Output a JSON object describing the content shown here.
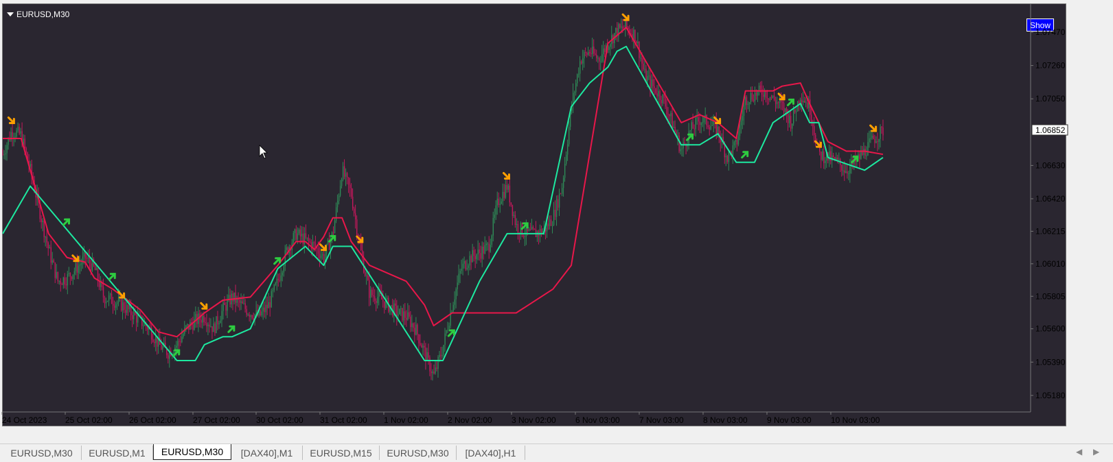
{
  "window": {
    "symbol_label": "EURUSD,M30",
    "show_button_label": "Show"
  },
  "price_axis": {
    "ticks": [
      "1.07470",
      "1.07260",
      "1.07050",
      "1.06630",
      "1.06420",
      "1.06215",
      "1.06010",
      "1.05805",
      "1.05600",
      "1.05390",
      "1.05180"
    ],
    "current_price": "1.06852"
  },
  "time_axis": {
    "labels": [
      "24 Oct 2023",
      "25 Oct 02:00",
      "26 Oct 02:00",
      "27 Oct 02:00",
      "30 Oct 02:00",
      "31 Oct 02:00",
      "1 Nov 02:00",
      "2 Nov 02:00",
      "3 Nov 02:00",
      "6 Nov 03:00",
      "7 Nov 03:00",
      "8 Nov 03:00",
      "9 Nov 03:00",
      "10 Nov 03:00"
    ]
  },
  "tabs": [
    {
      "label": "EURUSD,M30",
      "active": false
    },
    {
      "label": "EURUSD,M1",
      "active": false
    },
    {
      "label": "EURUSD,M30",
      "active": true
    },
    {
      "label": "[DAX40],M1",
      "active": false
    },
    {
      "label": "EURUSD,M15",
      "active": false
    },
    {
      "label": "EURUSD,M30",
      "active": false
    },
    {
      "label": "[DAX40],H1",
      "active": false
    }
  ],
  "colors": {
    "background": "#2a2630",
    "bull_candle": "#2e8b57",
    "bear_candle": "#c2185b",
    "upper_band": "#e8174a",
    "lower_band": "#1de9a0",
    "sell_arrow": "#ffa000",
    "buy_arrow": "#2ecc40",
    "show_button": "#0000ff"
  },
  "chart_data": {
    "type": "candlestick",
    "title": "EURUSD,M30",
    "ylim": [
      1.0508,
      1.0763
    ],
    "price_path": [
      [
        0,
        1.067
      ],
      [
        1,
        1.0685
      ],
      [
        2,
        1.0682
      ],
      [
        3,
        1.066
      ],
      [
        4,
        1.0635
      ],
      [
        5,
        1.061
      ],
      [
        6,
        1.059
      ],
      [
        7,
        1.0592
      ],
      [
        8,
        1.0598
      ],
      [
        9,
        1.0605
      ],
      [
        10,
        1.0598
      ],
      [
        11,
        1.058
      ],
      [
        12,
        1.0578
      ],
      [
        13,
        1.0575
      ],
      [
        14,
        1.057
      ],
      [
        15,
        1.0565
      ],
      [
        16,
        1.056
      ],
      [
        17,
        1.055
      ],
      [
        18,
        1.0545
      ],
      [
        19,
        1.055
      ],
      [
        20,
        1.056
      ],
      [
        21,
        1.0565
      ],
      [
        22,
        1.0568
      ],
      [
        23,
        1.056
      ],
      [
        24,
        1.0572
      ],
      [
        25,
        1.058
      ],
      [
        26,
        1.0575
      ],
      [
        27,
        1.057
      ],
      [
        28,
        1.0568
      ],
      [
        29,
        1.0575
      ],
      [
        30,
        1.059
      ],
      [
        31,
        1.061
      ],
      [
        32,
        1.062
      ],
      [
        33,
        1.0616
      ],
      [
        34,
        1.0612
      ],
      [
        35,
        1.0605
      ],
      [
        36,
        1.062
      ],
      [
        37,
        1.066
      ],
      [
        38,
        1.0645
      ],
      [
        39,
        1.061
      ],
      [
        40,
        1.0582
      ],
      [
        41,
        1.058
      ],
      [
        42,
        1.0575
      ],
      [
        43,
        1.057
      ],
      [
        44,
        1.0568
      ],
      [
        45,
        1.056
      ],
      [
        46,
        1.0545
      ],
      [
        47,
        1.053
      ],
      [
        48,
        1.0548
      ],
      [
        49,
        1.0575
      ],
      [
        50,
        1.0598
      ],
      [
        51,
        1.0605
      ],
      [
        52,
        1.0608
      ],
      [
        53,
        1.0612
      ],
      [
        54,
        1.064
      ],
      [
        55,
        1.065
      ],
      [
        56,
        1.0625
      ],
      [
        57,
        1.062
      ],
      [
        58,
        1.062
      ],
      [
        59,
        1.0622
      ],
      [
        60,
        1.063
      ],
      [
        61,
        1.065
      ],
      [
        62,
        1.07
      ],
      [
        63,
        1.073
      ],
      [
        64,
        1.0735
      ],
      [
        65,
        1.073
      ],
      [
        66,
        1.074
      ],
      [
        67,
        1.0748
      ],
      [
        68,
        1.075
      ],
      [
        69,
        1.0745
      ],
      [
        70,
        1.072
      ],
      [
        71,
        1.0712
      ],
      [
        72,
        1.0705
      ],
      [
        73,
        1.069
      ],
      [
        74,
        1.0672
      ],
      [
        75,
        1.0685
      ],
      [
        76,
        1.0692
      ],
      [
        77,
        1.069
      ],
      [
        78,
        1.0685
      ],
      [
        79,
        1.0668
      ],
      [
        80,
        1.0676
      ],
      [
        81,
        1.0705
      ],
      [
        82,
        1.0708
      ],
      [
        83,
        1.071
      ],
      [
        84,
        1.0705
      ],
      [
        85,
        1.07
      ],
      [
        86,
        1.069
      ],
      [
        87,
        1.0708
      ],
      [
        88,
        1.07
      ],
      [
        89,
        1.067
      ],
      [
        90,
        1.0668
      ],
      [
        91,
        1.0665
      ],
      [
        92,
        1.066
      ],
      [
        93,
        1.0665
      ],
      [
        94,
        1.0672
      ],
      [
        95,
        1.068
      ],
      [
        96,
        1.0685
      ]
    ],
    "upper_band": [
      [
        0,
        1.068
      ],
      [
        2,
        1.068
      ],
      [
        3,
        1.066
      ],
      [
        5,
        1.062
      ],
      [
        7,
        1.0605
      ],
      [
        9,
        1.0602
      ],
      [
        10,
        1.0592
      ],
      [
        12,
        1.0585
      ],
      [
        15,
        1.0572
      ],
      [
        17,
        1.0558
      ],
      [
        19,
        1.0555
      ],
      [
        22,
        1.057
      ],
      [
        24,
        1.0578
      ],
      [
        27,
        1.058
      ],
      [
        30,
        1.06
      ],
      [
        32,
        1.0615
      ],
      [
        33,
        1.0615
      ],
      [
        34,
        1.061
      ],
      [
        35,
        1.0618
      ],
      [
        36,
        1.063
      ],
      [
        37,
        1.063
      ],
      [
        38,
        1.0615
      ],
      [
        40,
        1.06
      ],
      [
        44,
        1.059
      ],
      [
        46,
        1.0575
      ],
      [
        47,
        1.0562
      ],
      [
        49,
        1.057
      ],
      [
        56,
        1.057
      ],
      [
        60,
        1.0585
      ],
      [
        62,
        1.06
      ],
      [
        66,
        1.074
      ],
      [
        67,
        1.0745
      ],
      [
        68,
        1.075
      ],
      [
        70,
        1.073
      ],
      [
        73,
        1.07
      ],
      [
        74,
        1.069
      ],
      [
        76,
        1.0695
      ],
      [
        78,
        1.069
      ],
      [
        80,
        1.068
      ],
      [
        81,
        1.071
      ],
      [
        84,
        1.071
      ],
      [
        85,
        1.0713
      ],
      [
        87,
        1.0715
      ],
      [
        88,
        1.0702
      ],
      [
        89,
        1.069
      ],
      [
        90,
        1.0678
      ],
      [
        92,
        1.0672
      ],
      [
        94,
        1.0672
      ],
      [
        96,
        1.067
      ]
    ],
    "lower_band": [
      [
        0,
        1.062
      ],
      [
        2,
        1.064
      ],
      [
        3,
        1.065
      ],
      [
        19,
        1.054
      ],
      [
        20,
        1.054
      ],
      [
        21,
        1.054
      ],
      [
        22,
        1.055
      ],
      [
        24,
        1.0555
      ],
      [
        25,
        1.0555
      ],
      [
        27,
        1.056
      ],
      [
        30,
        1.0598
      ],
      [
        33,
        1.0612
      ],
      [
        35,
        1.06
      ],
      [
        36,
        1.0612
      ],
      [
        38,
        1.0612
      ],
      [
        46,
        1.054
      ],
      [
        47,
        1.054
      ],
      [
        48,
        1.054
      ],
      [
        52,
        1.059
      ],
      [
        55,
        1.062
      ],
      [
        58,
        1.062
      ],
      [
        59,
        1.062
      ],
      [
        62,
        1.07
      ],
      [
        64,
        1.0715
      ],
      [
        66,
        1.0725
      ],
      [
        67,
        1.0735
      ],
      [
        68,
        1.0738
      ],
      [
        74,
        1.0676
      ],
      [
        76,
        1.0676
      ],
      [
        78,
        1.0683
      ],
      [
        80,
        1.0665
      ],
      [
        82,
        1.0665
      ],
      [
        84,
        1.069
      ],
      [
        86,
        1.0698
      ],
      [
        87,
        1.0702
      ],
      [
        88,
        1.069
      ],
      [
        89,
        1.069
      ],
      [
        90,
        1.0668
      ],
      [
        94,
        1.066
      ],
      [
        96,
        1.0668
      ]
    ],
    "sell_signals": [
      1,
      8,
      13,
      22,
      35,
      39,
      55,
      68,
      78,
      85,
      89,
      95
    ],
    "buy_signals": [
      7,
      12,
      19,
      25,
      30,
      36,
      49,
      57,
      75,
      81,
      86,
      93
    ]
  }
}
